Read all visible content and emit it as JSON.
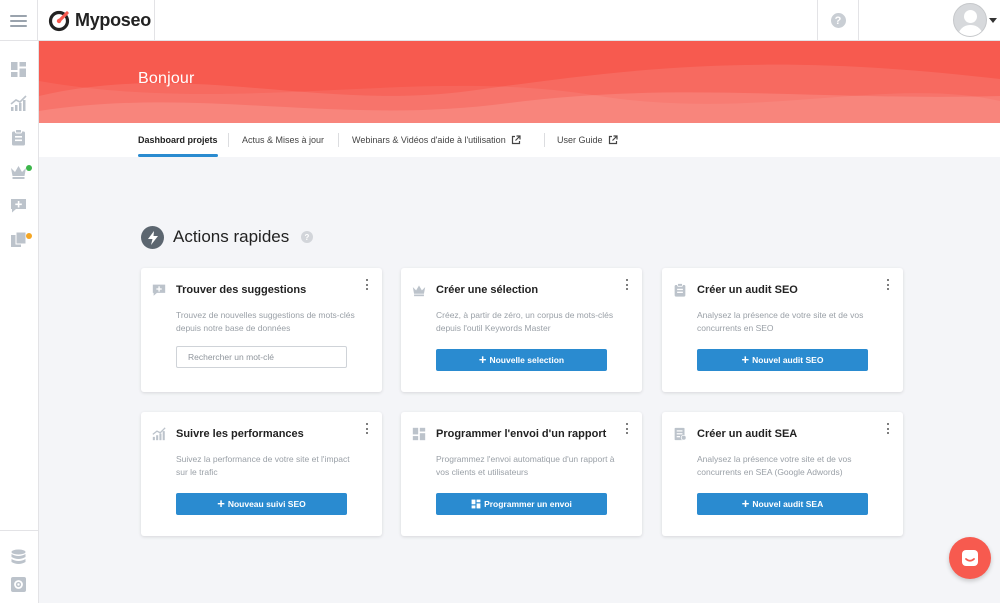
{
  "app": {
    "name": "Myposeo",
    "brand_color": "#f75a4f",
    "accent": "#2a8bd0"
  },
  "topbar": {
    "help_glyph": "?",
    "help_icon": "question-circle-icon",
    "avatar_icon": "user-avatar-icon"
  },
  "sidebar": {
    "items": [
      {
        "icon": "dashboard-icon"
      },
      {
        "icon": "chart-icon"
      },
      {
        "icon": "clipboard-icon"
      },
      {
        "icon": "crown-icon",
        "dot": "#3cb64a"
      },
      {
        "icon": "message-plus-icon"
      },
      {
        "icon": "calendar-icon",
        "dot": "#f5a623"
      }
    ],
    "bottom": [
      {
        "icon": "database-icon"
      },
      {
        "icon": "settings-icon"
      }
    ]
  },
  "banner": {
    "greeting": "Bonjour"
  },
  "tabs": [
    {
      "label": "Dashboard projets",
      "active": true
    },
    {
      "label": "Actus & Mises à jour"
    },
    {
      "label": "Webinars & Vidéos d'aide à l'utilisation",
      "external": true
    },
    {
      "label": "User Guide",
      "external": true
    }
  ],
  "quick_actions": {
    "title": "Actions rapides",
    "help_glyph": "?",
    "cards": [
      {
        "title": "Trouver des suggestions",
        "desc": "Trouvez de nouvelles suggestions de mots-clés depuis notre base de données",
        "input_placeholder": "Rechercher un mot-clé",
        "icon": "message-plus-icon"
      },
      {
        "title": "Créer une sélection",
        "desc": "Créez, à partir de zéro, un corpus de mots-clés depuis l'outil Keywords Master",
        "button": "Nouvelle selection",
        "icon": "crown-icon"
      },
      {
        "title": "Créer un audit SEO",
        "desc": "Analysez la présence de votre site et de vos concurrents en SEO",
        "button": "Nouvel audit SEO",
        "icon": "clipboard-icon"
      },
      {
        "title": "Suivre les performances",
        "desc": "Suivez la performance de votre site et l'impact sur le trafic",
        "button": "Nouveau suivi SEO",
        "icon": "chart-icon"
      },
      {
        "title": "Programmer l'envoi d'un rapport",
        "desc": "Programmez l'envoi automatique d'un rapport à vos clients et utilisateurs",
        "button": "Programmer un envoi",
        "icon": "dashboard-icon"
      },
      {
        "title": "Créer un audit SEA",
        "desc": "Analysez la présence votre site et de vos concurrents en SEA (Google Adwords)",
        "button": "Nouvel audit SEA",
        "icon": "document-icon"
      }
    ]
  },
  "chat": {
    "icon": "chat-icon"
  }
}
